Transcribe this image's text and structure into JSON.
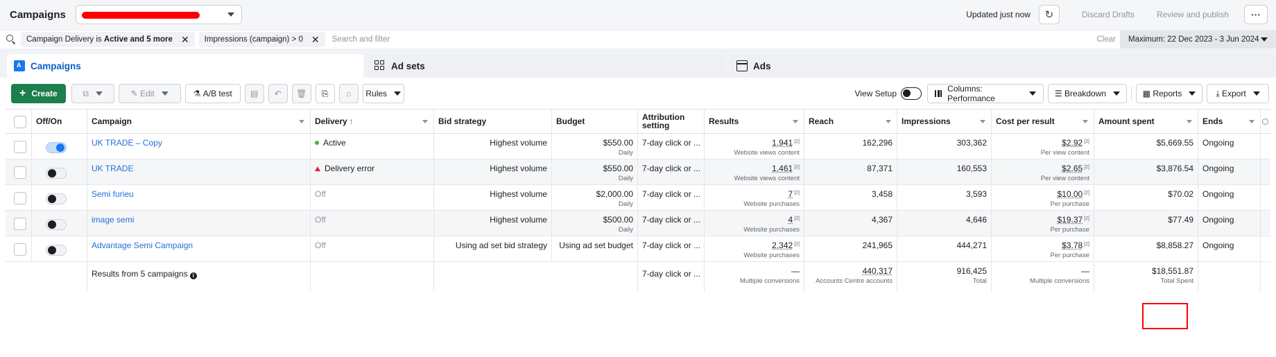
{
  "header": {
    "title": "Campaigns",
    "updated": "Updated just now",
    "discard": "Discard Drafts",
    "review": "Review and publish",
    "more": "···"
  },
  "filters": {
    "chip1_prefix": "Campaign Delivery is ",
    "chip1_bold": "Active and 5 more",
    "chip2": "Impressions (campaign) > 0",
    "search_placeholder": "Search and filter",
    "clear": "Clear",
    "date_range": "Maximum: 22 Dec 2023 - 3 Jun 2024"
  },
  "tabs": {
    "campaigns": "Campaigns",
    "adsets": "Ad sets",
    "ads": "Ads"
  },
  "toolbar": {
    "create": "Create",
    "edit": "Edit",
    "ab_test": "A/B test",
    "rules": "Rules",
    "view_setup": "View Setup",
    "columns": "Columns: Performance",
    "breakdown": "Breakdown",
    "reports": "Reports",
    "export": "Export"
  },
  "columns": {
    "offon": "Off/On",
    "campaign": "Campaign",
    "delivery": "Delivery",
    "bid": "Bid strategy",
    "budget": "Budget",
    "attribution": "Attribution setting",
    "results": "Results",
    "reach": "Reach",
    "impressions": "Impressions",
    "cpr": "Cost per result",
    "amount": "Amount spent",
    "ends": "Ends"
  },
  "rows": [
    {
      "name": "UK TRADE – Copy",
      "on": true,
      "delivery": "Active",
      "status": "active",
      "bid": "Highest volume",
      "budget": "$550.00",
      "budget_sub": "Daily",
      "attribution": "7-day click or ...",
      "results": "1,941",
      "results_sub": "Website views content",
      "reach": "162,296",
      "impressions": "303,362",
      "cpr": "$2.92",
      "cpr_sub": "Per view content",
      "amount": "$5,669.55",
      "ends": "Ongoing"
    },
    {
      "name": "UK TRADE",
      "on": false,
      "delivery": "Delivery error",
      "status": "error",
      "bid": "Highest volume",
      "budget": "$550.00",
      "budget_sub": "Daily",
      "attribution": "7-day click or ...",
      "results": "1,461",
      "results_sub": "Website views content",
      "reach": "87,371",
      "impressions": "160,553",
      "cpr": "$2.65",
      "cpr_sub": "Per view content",
      "amount": "$3,876.54",
      "ends": "Ongoing"
    },
    {
      "name": "Semi furieu",
      "on": false,
      "delivery": "Off",
      "status": "off",
      "bid": "Highest volume",
      "budget": "$2,000.00",
      "budget_sub": "Daily",
      "attribution": "7-day click or ...",
      "results": "7",
      "results_sub": "Website purchases",
      "reach": "3,458",
      "impressions": "3,593",
      "cpr": "$10.00",
      "cpr_sub": "Per purchase",
      "amount": "$70.02",
      "ends": "Ongoing"
    },
    {
      "name": "image semi",
      "on": false,
      "delivery": "Off",
      "status": "off",
      "bid": "Highest volume",
      "budget": "$500.00",
      "budget_sub": "Daily",
      "attribution": "7-day click or ...",
      "results": "4",
      "results_sub": "Website purchases",
      "reach": "4,367",
      "impressions": "4,646",
      "cpr": "$19.37",
      "cpr_sub": "Per purchase",
      "amount": "$77.49",
      "ends": "Ongoing"
    },
    {
      "name": "Advantage Semi Campaign",
      "on": false,
      "delivery": "Off",
      "status": "off",
      "bid": "Using ad set bid strategy",
      "budget": "Using ad set budget",
      "budget_sub": "",
      "attribution": "7-day click or ...",
      "results": "2,342",
      "results_sub": "Website purchases",
      "reach": "241,965",
      "impressions": "444,271",
      "cpr": "$3.78",
      "cpr_sub": "Per purchase",
      "amount": "$8,858.27",
      "ends": "Ongoing"
    }
  ],
  "summary": {
    "label": "Results from 5 campaigns",
    "attribution": "7-day click or ...",
    "results": "—",
    "results_sub": "Multiple conversions",
    "reach": "440,317",
    "reach_sub": "Accounts Centre accounts",
    "impressions": "916,425",
    "impressions_sub": "Total",
    "cpr": "—",
    "cpr_sub": "Multiple conversions",
    "amount": "$18,551.87",
    "amount_sub": "Total Spent"
  },
  "footnote": "[2]",
  "colors": {
    "accent": "#1877f2",
    "create": "#1b7f4e",
    "error": "#e41e3f",
    "active": "#42b72a",
    "highlight": "#ff0000"
  }
}
